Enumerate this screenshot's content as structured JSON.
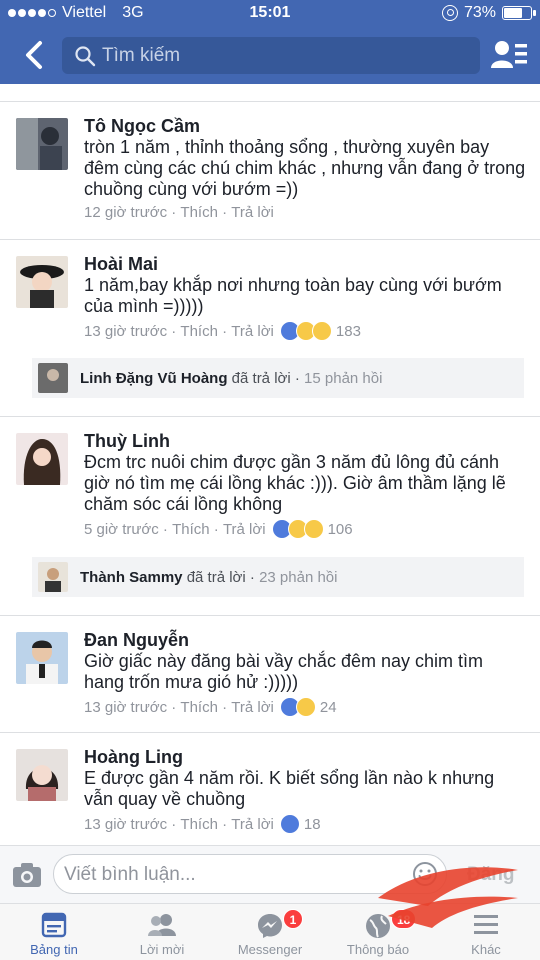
{
  "status_bar": {
    "carrier": "Viettel",
    "network": "3G",
    "time": "15:01",
    "battery": "73%",
    "battery_level": 0.73,
    "signal_bars_filled": 4
  },
  "header": {
    "back_icon": "chevron-left-icon",
    "search_placeholder": "Tìm kiếm",
    "friends_icon": "friends-list-icon",
    "brand_color": "#4267b2"
  },
  "comments": [
    {
      "name": "Tô Ngọc Cầm",
      "text": "tròn 1 năm , thỉnh thoảng sổng , thường xuyên bay đêm cùng các chú chim khác , nhưng vẫn đang ở trong chuồng cùng với bướm =))",
      "time": "12 giờ trước",
      "like": "Thích",
      "reply": "Trả lời",
      "reactions": [],
      "reaction_count": ""
    },
    {
      "name": "Hoài Mai",
      "text": "1 năm,bay khắp nơi nhưng toàn bay cùng với bướm của mình =)))))",
      "time": "13 giờ trước",
      "like": "Thích",
      "reply": "Trả lời",
      "reactions": [
        "like",
        "haha",
        "wow"
      ],
      "reaction_count": "183",
      "reply_summary": {
        "name": "Linh Đặng Vũ Hoàng",
        "action": "đã trả lời",
        "count": "15 phản hồi"
      }
    },
    {
      "name": "Thuỳ Linh",
      "text": "Đcm trc nuôi chim được gần 3 năm đủ lông đủ cánh giờ nó tìm mẹ cái lồng khác :))). Giờ âm thầm lặng lẽ chăm sóc cái lồng không",
      "time": "5 giờ trước",
      "like": "Thích",
      "reply": "Trả lời",
      "reactions": [
        "like",
        "haha",
        "sad"
      ],
      "reaction_count": "106",
      "reply_summary": {
        "name": "Thành Sammy",
        "action": "đã trả lời",
        "count": "23 phản hồi"
      }
    },
    {
      "name": "Đan Nguyễn",
      "text": "Giờ giấc này đăng bài vầy chắc đêm nay chim tìm hang trốn mưa gió hử :)))))",
      "time": "13 giờ trước",
      "like": "Thích",
      "reply": "Trả lời",
      "reactions": [
        "like",
        "haha"
      ],
      "reaction_count": "24"
    },
    {
      "name": "Hoàng Ling",
      "text": "E được gần 4 năm rồi. K biết sổng lần nào k nhưng vẫn quay về chuồng",
      "time": "13 giờ trước",
      "like": "Thích",
      "reply": "Trả lời",
      "reactions": [
        "like"
      ],
      "reaction_count": "18"
    }
  ],
  "composer": {
    "placeholder": "Viết bình luận...",
    "post_label": "Đăng",
    "camera_icon": "camera-icon",
    "emoji_icon": "smiley-icon"
  },
  "tabbar": {
    "tabs": [
      {
        "label": "Bảng tin",
        "icon": "news-feed-icon",
        "active": true
      },
      {
        "label": "Lời mời",
        "icon": "friend-requests-icon"
      },
      {
        "label": "Messenger",
        "icon": "messenger-icon",
        "badge": "1"
      },
      {
        "label": "Thông báo",
        "icon": "globe-icon",
        "badge": "18"
      },
      {
        "label": "Khác",
        "icon": "menu-icon"
      }
    ]
  }
}
